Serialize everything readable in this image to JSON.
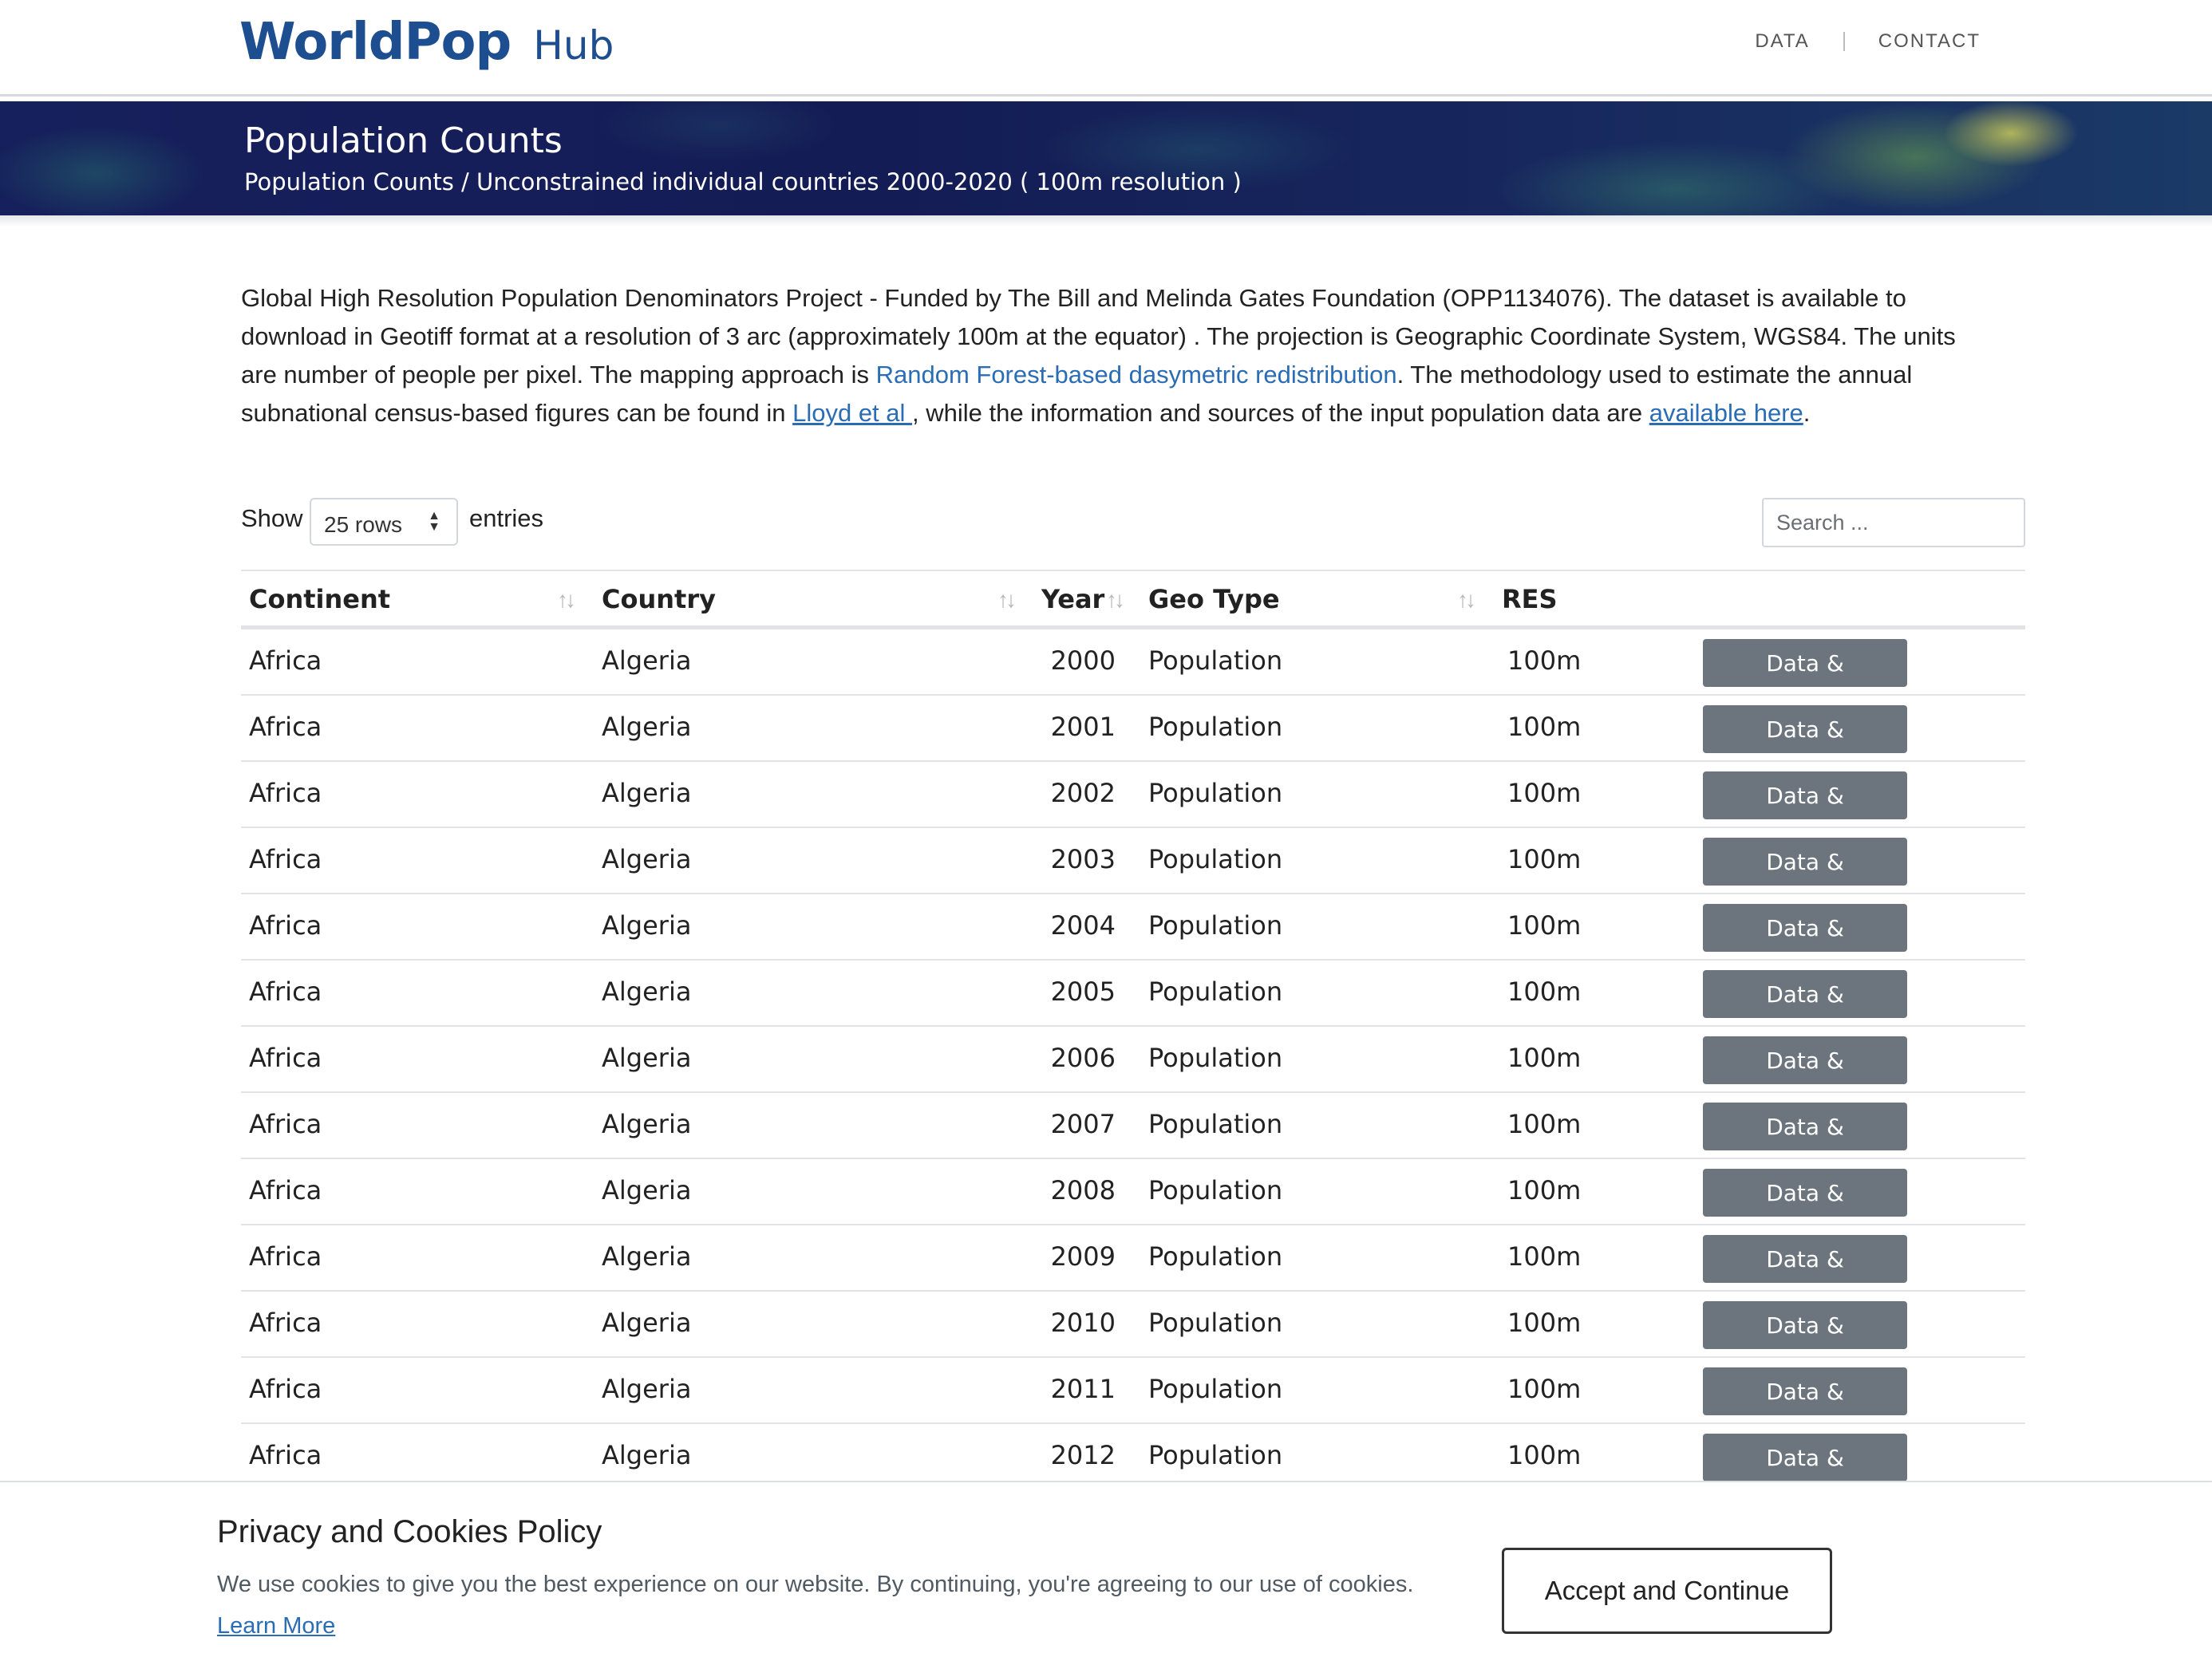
{
  "header": {
    "logo_text": "WorldPop",
    "hub_text": "Hub",
    "nav": {
      "data_label": "DATA",
      "contact_label": "CONTACT"
    }
  },
  "banner": {
    "title": "Population Counts",
    "breadcrumb": "Population Counts / Unconstrained individual countries 2000-2020 ( 100m resolution )"
  },
  "description": {
    "part1": "Global High Resolution Population Denominators Project - Funded by The Bill and Melinda Gates Foundation (OPP1134076). The dataset is available to download in Geotiff format at a resolution of 3 arc (approximately 100m at the equator) . The projection is Geographic Coordinate System, WGS84. The units are number of people per pixel. The mapping  approach is ",
    "link_method": "Random Forest-based dasymetric redistribution",
    "part2": ".  The methodology used to estimate the annual subnational census-based figures can be found in ",
    "link_lloyd": "Lloyd et al ",
    "part3": ", while the information and sources of the input population data are ",
    "link_available": "available here",
    "part4": "."
  },
  "controls": {
    "show_label": "Show",
    "rows_value": "25 rows",
    "entries_label": "entries",
    "search_placeholder": "Search ..."
  },
  "table": {
    "columns": {
      "continent": "Continent",
      "country": "Country",
      "year": "Year",
      "geotype": "Geo Type",
      "res": "RES"
    },
    "button_label": "Data & Resources",
    "rows": [
      {
        "continent": "Africa",
        "country": "Algeria",
        "year": "2000",
        "geotype": "Population",
        "res": "100m"
      },
      {
        "continent": "Africa",
        "country": "Algeria",
        "year": "2001",
        "geotype": "Population",
        "res": "100m"
      },
      {
        "continent": "Africa",
        "country": "Algeria",
        "year": "2002",
        "geotype": "Population",
        "res": "100m"
      },
      {
        "continent": "Africa",
        "country": "Algeria",
        "year": "2003",
        "geotype": "Population",
        "res": "100m"
      },
      {
        "continent": "Africa",
        "country": "Algeria",
        "year": "2004",
        "geotype": "Population",
        "res": "100m"
      },
      {
        "continent": "Africa",
        "country": "Algeria",
        "year": "2005",
        "geotype": "Population",
        "res": "100m"
      },
      {
        "continent": "Africa",
        "country": "Algeria",
        "year": "2006",
        "geotype": "Population",
        "res": "100m"
      },
      {
        "continent": "Africa",
        "country": "Algeria",
        "year": "2007",
        "geotype": "Population",
        "res": "100m"
      },
      {
        "continent": "Africa",
        "country": "Algeria",
        "year": "2008",
        "geotype": "Population",
        "res": "100m"
      },
      {
        "continent": "Africa",
        "country": "Algeria",
        "year": "2009",
        "geotype": "Population",
        "res": "100m"
      },
      {
        "continent": "Africa",
        "country": "Algeria",
        "year": "2010",
        "geotype": "Population",
        "res": "100m"
      },
      {
        "continent": "Africa",
        "country": "Algeria",
        "year": "2011",
        "geotype": "Population",
        "res": "100m"
      },
      {
        "continent": "Africa",
        "country": "Algeria",
        "year": "2012",
        "geotype": "Population",
        "res": "100m"
      }
    ]
  },
  "cookie": {
    "title": "Privacy and Cookies Policy",
    "text": "We use cookies to give you the best experience on our website. By continuing, you're agreeing to our use of cookies.",
    "learn_more": "Learn More",
    "accept_label": "Accept and Continue"
  },
  "colors": {
    "brand": "#1d4e8f",
    "link": "#2a6db4",
    "button": "#6c757d",
    "banner": "#16205c"
  }
}
